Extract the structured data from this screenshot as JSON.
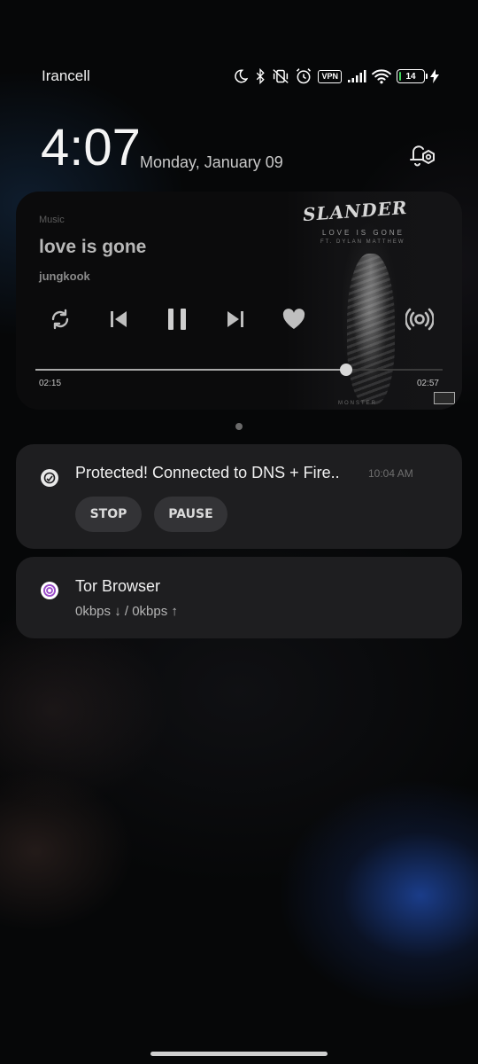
{
  "status_bar": {
    "carrier": "Irancell",
    "vpn_label": "VPN",
    "battery_level": "14",
    "battery_fraction": 0.14,
    "icons": [
      "moon-icon",
      "bluetooth-icon",
      "mute-vibrate-icon",
      "alarm-icon",
      "vpn-icon",
      "signal-icon",
      "wifi-icon",
      "battery-icon",
      "charging-icon"
    ]
  },
  "lockscreen": {
    "time": "4:07",
    "date": "Monday, January 09"
  },
  "media_player": {
    "app_name": "Music",
    "song_title": "love is gone",
    "artist": "jungkook",
    "current_time": "02:15",
    "total_time": "02:57",
    "progress_fraction": 0.7627,
    "album_art": {
      "brand": "SLANDER",
      "subtitle": "LOVE IS GONE",
      "featuring": "FT. DYLAN MATTHEW",
      "footer": "MONSTER"
    }
  },
  "notifications": [
    {
      "icon": "shield-icon",
      "title": "Protected! Connected to DNS + Fire..",
      "time": "10:04 AM",
      "actions": [
        "STOP",
        "PAUSE"
      ]
    },
    {
      "icon": "tor-onion-icon",
      "title": "Tor Browser",
      "subtitle": "0kbps ↓ / 0kbps ↑"
    }
  ],
  "colors": {
    "battery": "#3fd45a",
    "tor_accent": "#9b4dca",
    "card": "#1e1e20"
  }
}
